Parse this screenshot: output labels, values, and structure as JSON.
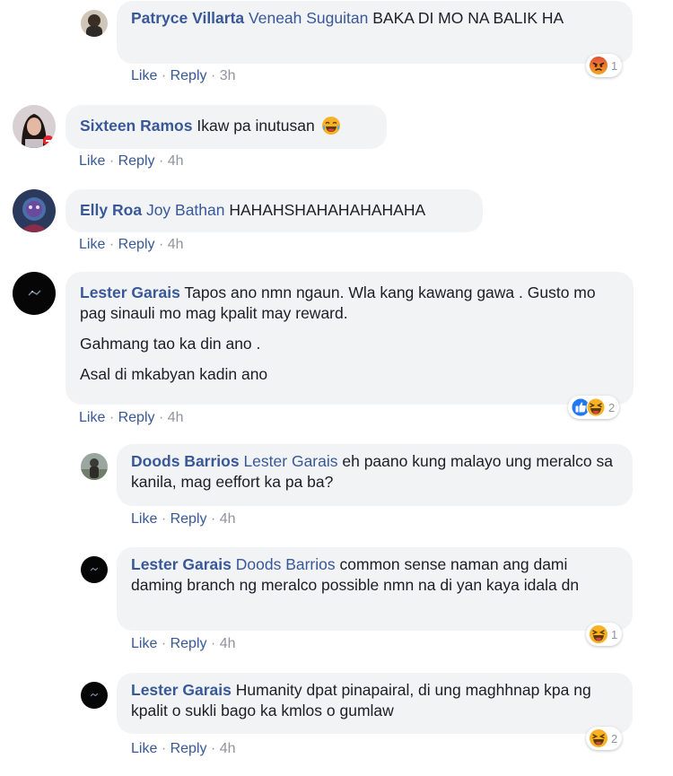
{
  "labels": {
    "like": "Like",
    "reply": "Reply",
    "sep": "·"
  },
  "comments": [
    {
      "author": "Patryce Villarta",
      "mention": "Veneah Suguitan",
      "text": "BAKA DI MO NA BALIK HA",
      "time": "3h",
      "reaction": {
        "icons": [
          "angry-icon"
        ],
        "count": "1"
      }
    },
    {
      "author": "Sixteen Ramos",
      "text": "Ikaw pa inutusan",
      "emoji": "laughing-emoji-icon",
      "time": "4h"
    },
    {
      "author": "Elly Roa",
      "mention": "Joy Bathan",
      "text": "HAHAHSHAHAHAHAHAHA",
      "time": "4h"
    },
    {
      "author": "Lester Garais",
      "paragraphs": [
        "Tapos ano nmn ngaun. Wla kang kawang gawa . Gusto mo pag sinauli mo mag kpalit may reward.",
        "Gahmang tao ka din ano .",
        "Asal di mkabyan kadin ano"
      ],
      "time": "4h",
      "reaction": {
        "icons": [
          "like-icon",
          "haha-icon"
        ],
        "count": "2"
      }
    },
    {
      "author": "Doods Barrios",
      "mention": "Lester Garais",
      "text": "eh paano kung malayo ung meralco sa kanila, mag eeffort ka pa ba?",
      "time": "4h"
    },
    {
      "author": "Lester Garais",
      "mention": "Doods Barrios",
      "text": "common sense naman ang dami daming branch ng meralco possible nmn na di yan kaya idala dn",
      "time": "4h",
      "reaction": {
        "icons": [
          "haha-icon"
        ],
        "count": "1"
      }
    },
    {
      "author": "Lester Garais",
      "text": "Humanity dpat pinapairal, di ung maghhnap kpa ng kpalit o sukli bago ka kmlos o gumlaw",
      "time": "4h",
      "reaction": {
        "icons": [
          "haha-icon"
        ],
        "count": "2"
      }
    }
  ],
  "colors": {
    "link": "#385898",
    "bubble": "#f2f3f5",
    "meta": "#90949c",
    "like_blue": "#2078f4",
    "haha_yellow": "#f7b125",
    "angry_orange": "#e9710f"
  }
}
